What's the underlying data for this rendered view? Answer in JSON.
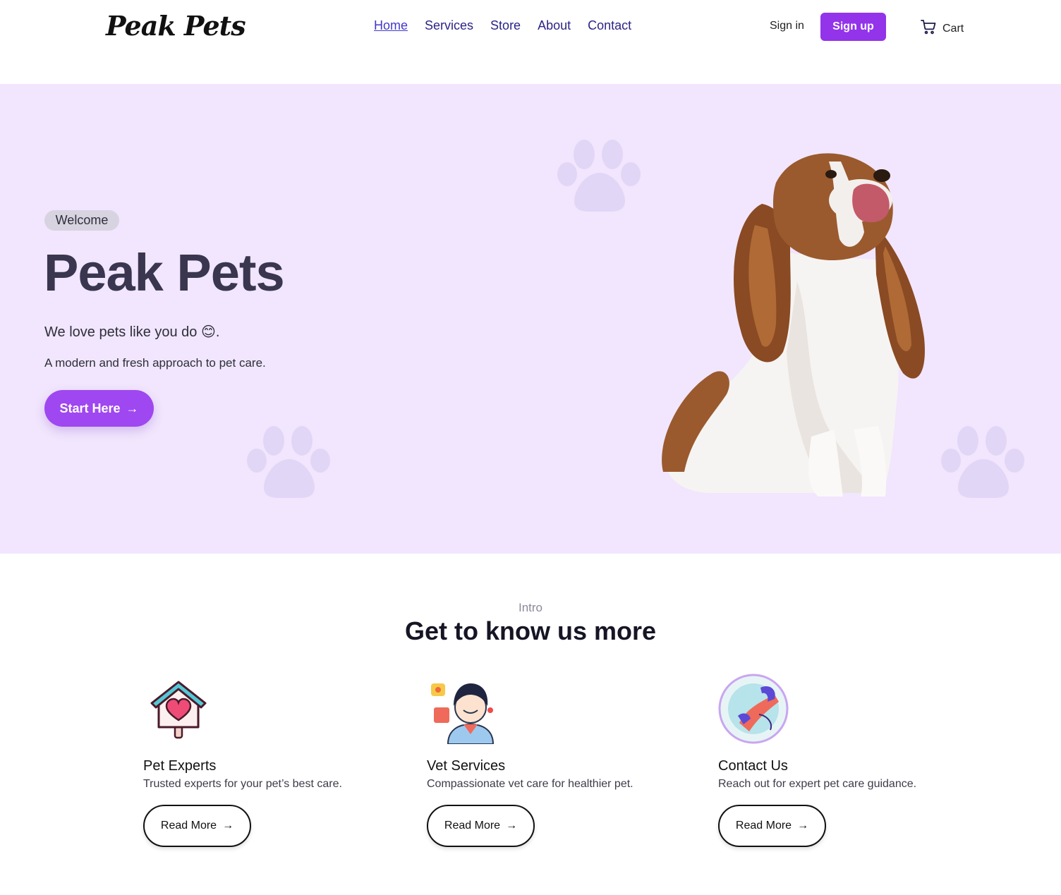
{
  "header": {
    "logo": "Peak Pets",
    "nav": [
      {
        "label": "Home",
        "active": true
      },
      {
        "label": "Services",
        "active": false
      },
      {
        "label": "Store",
        "active": false
      },
      {
        "label": "About",
        "active": false
      },
      {
        "label": "Contact",
        "active": false
      }
    ],
    "signin_label": "Sign in",
    "signup_label": "Sign up",
    "cart_label": "Cart"
  },
  "hero": {
    "badge": "Welcome",
    "title": "Peak Pets",
    "subtitle": "We love pets like you do 😊.",
    "description": "A modern and fresh approach to pet care.",
    "cta_label": "Start Here",
    "cta_arrow": "→"
  },
  "intro": {
    "label": "Intro",
    "title": "Get to know us more",
    "cards": [
      {
        "icon": "pet-house-heart-icon",
        "title": "Pet Experts",
        "text": "Trusted experts for your pet’s best care.",
        "button": "Read More",
        "arrow": "→"
      },
      {
        "icon": "vet-support-agent-icon",
        "title": "Vet Services",
        "text": "Compassionate vet care for healthier pet.",
        "button": "Read More",
        "arrow": "→"
      },
      {
        "icon": "contact-us-phone-icon",
        "title": "Contact Us",
        "text": "Reach out for expert pet care guidance.",
        "button": "Read More",
        "arrow": "→"
      }
    ]
  },
  "colors": {
    "accent": "#9333ea",
    "hero_bg": "#f1e6fd",
    "nav_text": "#2b2486",
    "paw": "#e2d6f7"
  }
}
